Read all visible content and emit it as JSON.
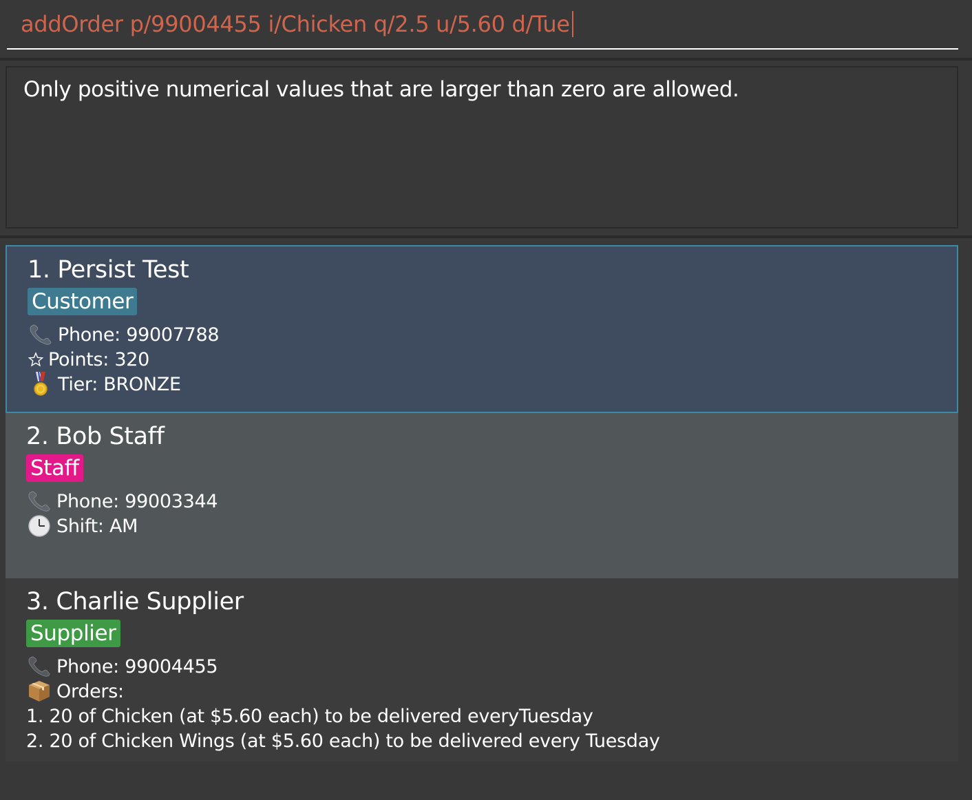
{
  "command": {
    "value": "addOrder p/99004455 i/Chicken q/2.5 u/5.60 d/Tue"
  },
  "result": {
    "message": "Only positive numerical values that are larger than zero are allowed."
  },
  "persons": [
    {
      "title": "1. Persist Test",
      "tag": "Customer",
      "phone": "Phone: 99007788",
      "points": "Points: 320",
      "tier": "Tier: BRONZE"
    },
    {
      "title": "2. Bob Staff",
      "tag": "Staff",
      "phone": "Phone: 99003344",
      "shift": "Shift: AM"
    },
    {
      "title": "3. Charlie Supplier",
      "tag": "Supplier",
      "phone": "Phone: 99004455",
      "orders_label": "Orders:",
      "orders": [
        "1. 20 of Chicken (at $5.60 each) to be delivered everyTuesday",
        "2. 20 of Chicken Wings (at $5.60 each) to be delivered every Tuesday"
      ]
    }
  ],
  "colors": {
    "command_text": "#d0654e",
    "customer_tag": "#3e7b91",
    "staff_tag": "#e3198a",
    "supplier_tag": "#3f9a45",
    "selected_card": "#3f4b5e"
  },
  "icons": {
    "phone": "phone-icon",
    "points": "star-icon",
    "tier": "medal-icon",
    "shift": "clock-icon",
    "orders": "package-icon"
  }
}
